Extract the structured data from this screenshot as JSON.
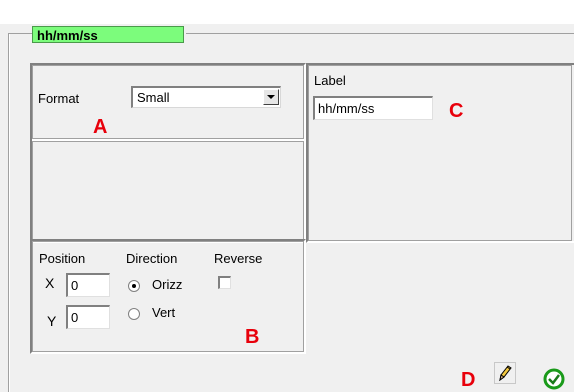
{
  "header": {
    "title": "hh/mm/ss"
  },
  "format_group": {
    "label": "Format",
    "selected": "Small",
    "marker": "A"
  },
  "label_group": {
    "label": "Label",
    "value": "hh/mm/ss",
    "marker": "C"
  },
  "position_group": {
    "position_label": "Position",
    "x_label": "X",
    "x_value": "0",
    "y_label": "Y",
    "y_value": "0",
    "direction_label": "Direction",
    "option_horizontal": "Orizz",
    "option_vertical": "Vert",
    "selected_direction": "Orizz",
    "reverse_label": "Reverse",
    "reverse_checked": false,
    "marker": "B"
  },
  "actions": {
    "edit_marker": "D",
    "edit_icon": "pencil-icon",
    "ok_icon": "check-circle-icon"
  },
  "colors": {
    "title_highlight": "#7cfc7c",
    "marker": "#e8000b",
    "ok_green": "#1a9a1a"
  }
}
